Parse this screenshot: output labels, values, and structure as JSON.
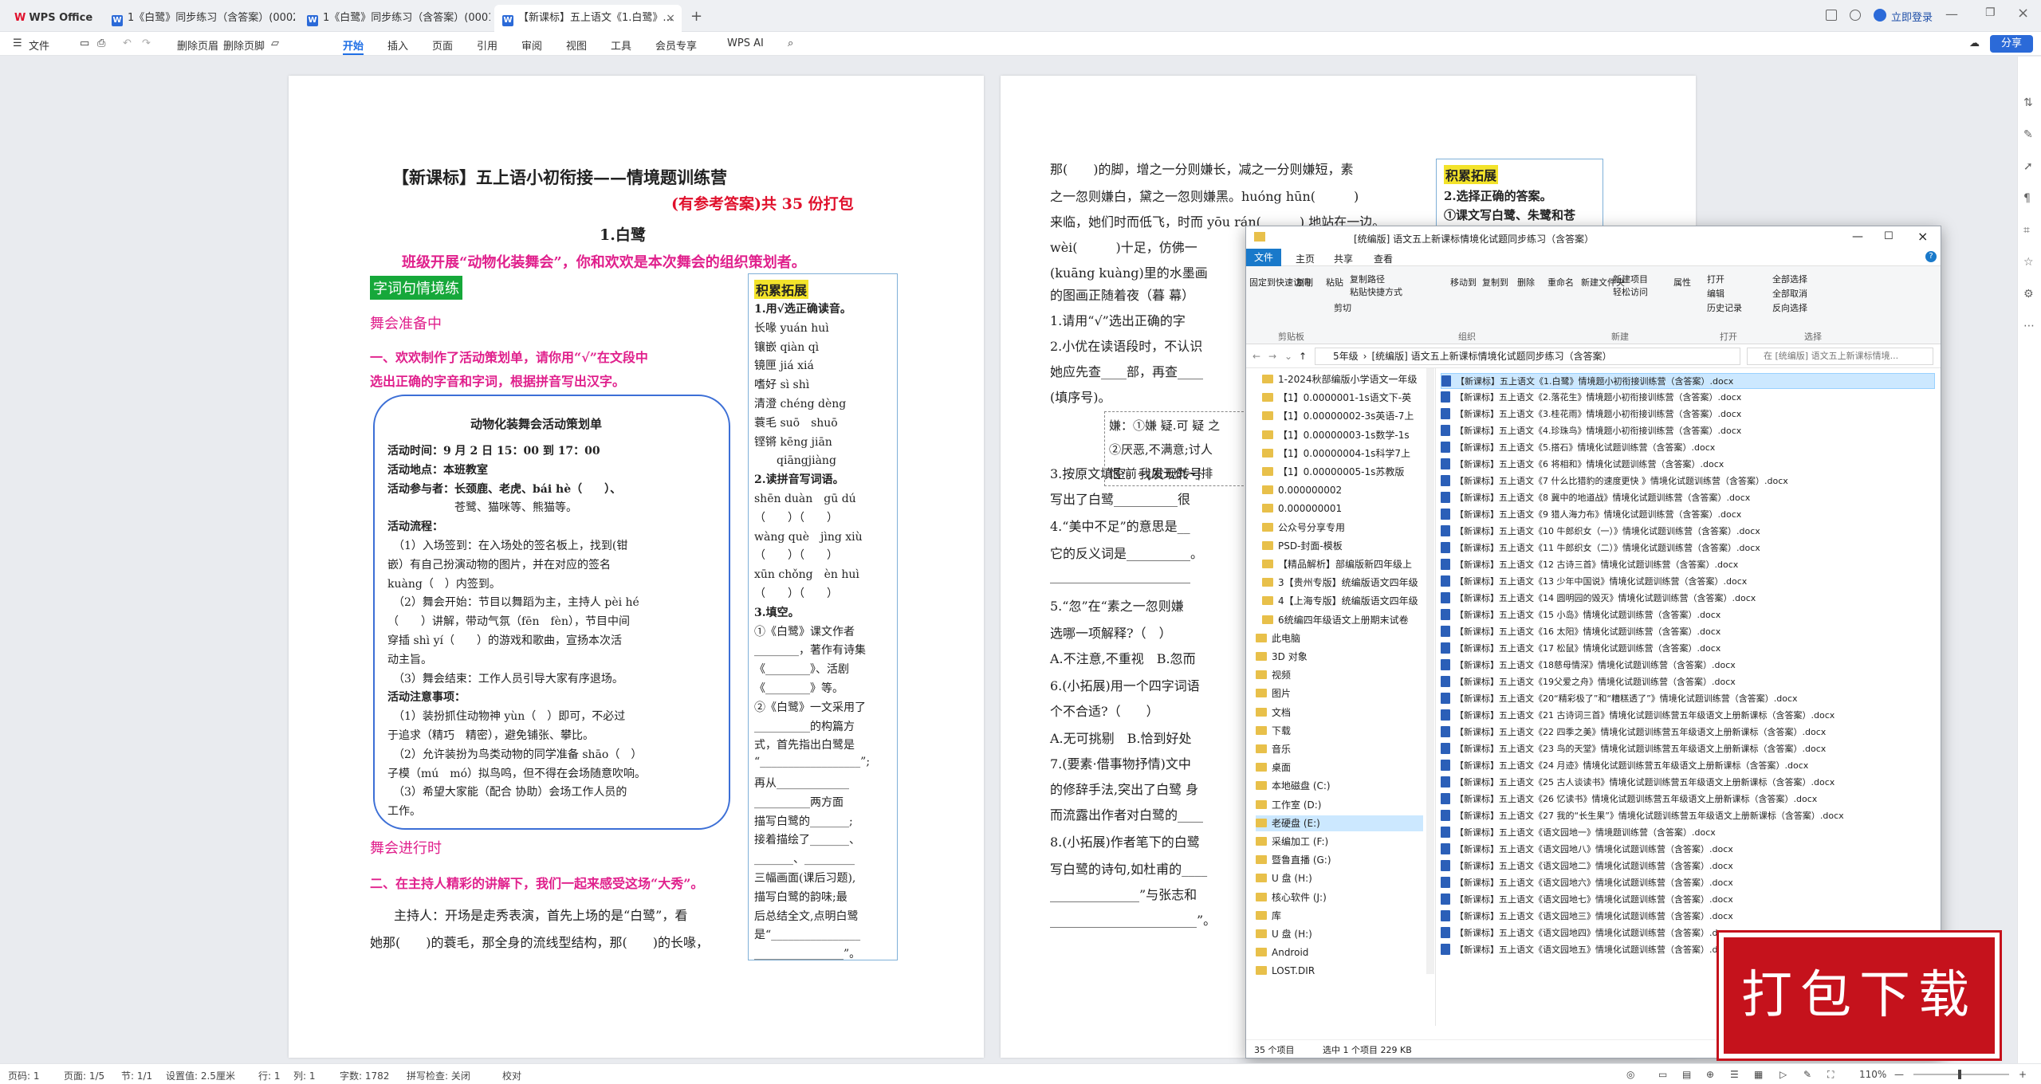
{
  "tabs": [
    {
      "label": "WPS Office"
    },
    {
      "label": "1《白鹭》同步练习（含答案）(0002..."
    },
    {
      "label": "1《白鹭》同步练习（含答案）(0001..."
    },
    {
      "label": "【新课标】五上语文《1.白鹭》..."
    }
  ],
  "titlebar": {
    "login": "立即登录",
    "add_tab": "+"
  },
  "menu": {
    "file": "文件",
    "delete_page": "删除页眉",
    "delete_footer": "删除页脚",
    "items": [
      "开始",
      "插入",
      "页面",
      "引用",
      "审阅",
      "视图",
      "工具",
      "会员专享"
    ],
    "ai": "WPS AI",
    "share": "分享"
  },
  "page1": {
    "title": "【新课标】五上语小初衔接——情境题训练营",
    "subtitle": "(有参考答案)共 35 份打包",
    "lesson": "1.白鹭",
    "intro": "班级开展“动物化装舞会”，你和欢欢是本次舞会的组织策划者。",
    "section1": "字词句情境练",
    "h_prep": "舞会准备中",
    "q1": "一、欢欢制作了活动策划单，请你用“√”在文段中",
    "q1b": "选出正确的字音和字词，根据拼音写出汉字。",
    "plan_title": "动物化装舞会活动策划单",
    "plan_lines": [
      "活动时间：9 月 2 日 15：00 到 17：00",
      "活动地点：本班教室",
      "活动参与者：长颈鹿、老虎、bái hè（　　）、",
      "　　　　　　苍鹭、猫咪等、熊猫等。",
      "活动流程：",
      "　（1）入场签到：在入场处的签名板上，找到(钳",
      "嵌）有自己扮演动物的图片，并在对应的签名",
      "kuàng（　）内签到。",
      "　（2）舞会开始：节目以舞蹈为主，主持人 pèi hé",
      "（　　）讲解，带动气氛（fēn　fèn），节目中间",
      "穿插 shì yí（　　）的游戏和歌曲，宣扬本次活",
      "动主旨。",
      "　（3）舞会结束：工作人员引导大家有序退场。",
      "活动注意事项：",
      "　（1）装扮抓住动物神 yùn（　）即可，不必过",
      "于追求（精巧　精密），避免铺张、攀比。",
      "　（2）允许装扮为鸟类动物的同学准备 shāo（　）",
      "子模（mú　mó）拟鸟鸣，但不得在会场随意吹响。",
      "　（3）希望大家能（配合 协助）会场工作人员的",
      "工作。"
    ],
    "h_progress": "舞会进行时",
    "q2": "二、在主持人精彩的讲解下，我们一起来感受这场“大秀”。",
    "host_line": "主持人：开场是走秀表演，首先上场的是“白鹭”，看",
    "host_line2": "她那(　　)的蓑毛，那全身的流线型结构，那(　　)的长喙，",
    "side_title": "积累拓展",
    "side_lines": [
      "1.用√选正确读音。",
      "长喙 yuán huì",
      "镶嵌 qiàn qì",
      "镜匣 jiá xiá",
      "嗜好 sì shì",
      "清澄 chéng dèng",
      "蓑毛 suō　shuō",
      "铿锵 kēng jiān",
      "　　qiāngjiàng",
      "2.读拼音写词语。",
      "shēn duàn　gū dú",
      "（　　）（　　）",
      "wàng què　jìng xiù",
      "（　　）（　　）",
      "xūn chǒng　èn huì",
      "（　　）（　　）",
      "3.填空。",
      "①《白鹭》课文作者",
      "________，著作有诗集",
      "《________》、活剧",
      "《________》等。",
      "②《白鹭》一文采用了",
      "__________的构篇方",
      "式，首先指出白鹭是",
      "“__________________”;",
      "再从_____________",
      "__________两方面",
      "描写白鹭的_______;",
      "接着描绘了_______、",
      "_______、_________",
      "三幅画面(课后习题),",
      "描写白鹭的韵味;最",
      "后总结全文,点明白鹭",
      "是“________________",
      "________________”。"
    ]
  },
  "page2": {
    "lines": [
      "那(　　)的脚，增之一分则嫌长，减之一分则嫌短，素",
      "之一忽则嫌白，黛之一忽则嫌黑。huóng hūn(　　　)",
      "来临，她们时而低飞，时而 yōu rán(　　　) 地站在一边。",
      "wèi(　　　)十足，仿佛一",
      "(kuāng kuàng)里的水墨画",
      "的图画正随着夜（暮 幕）",
      "1.请用“√”选出正确的字",
      "2.小优在读语段时，不认识",
      "她应先查____部，再查____",
      "(填序号)。",
      "3.按原文填空。我发现转号",
      "写出了白鹭__________很",
      "4.“美中不足”的意思是__",
      "它的反义词是__________。",
      "______________________",
      "5.“忽”在“素之一忽则嫌",
      "选哪一项解释?（　）",
      "A.不注意,不重视　B.忽而",
      "6.(小拓展)用一个四字词语",
      "个不合适?（　　）",
      "A.无可挑剔　B.恰到好处",
      "7.(要素·借事物抒情)文中",
      "的修辞手法,突出了白鹭 身",
      "而流露出作者对白鹭的____",
      "8.(小拓展)作者笔下的白鹭",
      "写白鹭的诗句,如杜甫的____",
      "______________”与张志和",
      "_______________________”。"
    ],
    "box_lines": [
      "嫌：①嫌 疑.可 疑 之",
      "②厌恶,不满意;讨人",
      "恨:前~|夙无仇~|排"
    ],
    "side_title": "积累拓展",
    "side_lines": [
      "2.选择正确的答案。",
      "①课文写白鹭、朱鹭和苍"
    ]
  },
  "explorer": {
    "title": "[统编版] 语文五上新课标情境化试题同步练习（含答案）",
    "ribbon_tabs": [
      "文件",
      "主页",
      "共享",
      "查看"
    ],
    "groups": [
      "剪贴板",
      "组织",
      "新建",
      "打开",
      "选择"
    ],
    "buttons": [
      "固定到快速访问",
      "复制",
      "粘贴",
      "复制路径",
      "粘贴快捷方式",
      "剪切",
      "移动到",
      "复制到",
      "删除",
      "重命名",
      "新建文件夹",
      "新建项目",
      "轻松访问",
      "属性",
      "打开",
      "编辑",
      "历史记录",
      "全部选择",
      "全部取消",
      "反向选择"
    ],
    "path": [
      "5年级",
      "[统编版] 语文五上新课标情境化试题同步练习（含答案）"
    ],
    "search_placeholder": "在 [统编版] 语文五上新课标情境...",
    "nav": [
      {
        "label": "1-2024秋部编版小学语文一年级"
      },
      {
        "label": "【1】0.0000001-1s语文下-英"
      },
      {
        "label": "【1】0.00000002-3s英语-7上"
      },
      {
        "label": "【1】0.00000003-1s数学-1s"
      },
      {
        "label": "【1】0.00000004-1s科学7上"
      },
      {
        "label": "【1】0.00000005-1s苏教版"
      },
      {
        "label": "0.000000002"
      },
      {
        "label": "0.000000001"
      },
      {
        "label": "公众号分享专用"
      },
      {
        "label": "PSD-封面-模板"
      },
      {
        "label": "【精品解析】部编版新四年级上"
      },
      {
        "label": "3【贵州专版】统编版语文四年级"
      },
      {
        "label": "4【上海专版】统编版语文四年级"
      },
      {
        "label": "6统编四年级语文上册期末试卷"
      },
      {
        "label": "此电脑"
      },
      {
        "label": "3D 对象"
      },
      {
        "label": "视频"
      },
      {
        "label": "图片"
      },
      {
        "label": "文档"
      },
      {
        "label": "下载"
      },
      {
        "label": "音乐"
      },
      {
        "label": "桌面"
      },
      {
        "label": "本地磁盘 (C:)"
      },
      {
        "label": "工作室 (D:)"
      },
      {
        "label": "老硬盘 (E:)"
      },
      {
        "label": "采编加工 (F:)"
      },
      {
        "label": "暨鲁直播 (G:)"
      },
      {
        "label": "U 盘 (H:)"
      },
      {
        "label": "核心软件 (J:)"
      },
      {
        "label": "库"
      },
      {
        "label": "U 盘 (H:)"
      },
      {
        "label": "Android"
      },
      {
        "label": "LOST.DIR"
      }
    ],
    "files": [
      "【新课标】五上语文《1.白鹭》情境题小初衔接训练营（含答案）.docx",
      "【新课标】五上语文《2.落花生》情境题小初衔接训练营（含答案）.docx",
      "【新课标】五上语文《3.桂花雨》情境题小初衔接训练营（含答案）.docx",
      "【新课标】五上语文《4.珍珠鸟》情境题小初衔接训练营（含答案）.docx",
      "【新课标】五上语文《5.搭石》情境化试题训练营（含答案）.docx",
      "【新课标】五上语文《6 将相和》情境化试题训练营（含答案）.docx",
      "【新课标】五上语文《7 什么比猎豹的速度更快 》情境化试题训练营（含答案）.docx",
      "【新课标】五上语文《8 冀中的地道战》情境化试题训练营（含答案）.docx",
      "【新课标】五上语文《9 猎人海力布》情境化试题训练营（含答案）.docx",
      "【新课标】五上语文《10 牛郎织女（一）》情境化试题训练营（含答案）.docx",
      "【新课标】五上语文《11 牛郎织女（二）》情境化试题训练营（含答案）.docx",
      "【新课标】五上语文《12 古诗三首》情境化试题训练营（含答案）.docx",
      "【新课标】五上语文《13 少年中国说》情境化试题训练营（含答案）.docx",
      "【新课标】五上语文《14 圆明园的毁灭》情境化试题训练营（含答案）.docx",
      "【新课标】五上语文《15 小岛》情境化试题训练营（含答案）.docx",
      "【新课标】五上语文《16 太阳》情境化试题训练营（含答案）.docx",
      "【新课标】五上语文《17 松鼠》情境化试题训练营（含答案）.docx",
      "【新课标】五上语文《18慈母情深》情境化试题训练营（含答案）.docx",
      "【新课标】五上语文《19父爱之舟》情境化试题训练营（含答案）.docx",
      "【新课标】五上语文《20“精彩极了”和“糟糕透了”》情境化试题训练营（含答案）.docx",
      "【新课标】五上语文《21 古诗词三首》情境化试题训练营五年级语文上册新课标（含答案）.docx",
      "【新课标】五上语文《22 四季之美》情境化试题训练营五年级语文上册新课标（含答案）.docx",
      "【新课标】五上语文《23 鸟的天堂》情境化试题训练营五年级语文上册新课标（含答案）.docx",
      "【新课标】五上语文《24 月迹》情境化试题训练营五年级语文上册新课标（含答案）.docx",
      "【新课标】五上语文《25 古人谈读书》情境化试题训练营五年级语文上册新课标（含答案）.docx",
      "【新课标】五上语文《26 忆读书》情境化试题训练营五年级语文上册新课标（含答案）.docx",
      "【新课标】五上语文《27 我的“长生果”》情境化试题训练营五年级语文上册新课标（含答案）.docx",
      "【新课标】五上语文《语文园地一》情境题训练营（含答案）.docx",
      "【新课标】五上语文《语文园地八》情境化试题训练营（含答案）.docx",
      "【新课标】五上语文《语文园地二》情境化试题训练营（含答案）.docx",
      "【新课标】五上语文《语文园地六》情境化试题训练营（含答案）.docx",
      "【新课标】五上语文《语文园地七》情境化试题训练营（含答案）.docx",
      "【新课标】五上语文《语文园地三》情境化试题训练营（含答案）.docx",
      "【新课标】五上语文《语文园地四》情境化试题训练营（含答案）.docx",
      "【新课标】五上语文《语文园地五》情境化试题训练营（含答案）.docx"
    ],
    "status_count": "35 个项目",
    "status_selected": "选中 1 个项目  229 KB"
  },
  "stamp": "打包下载",
  "status": {
    "page_num": "页码: 1",
    "pages": "页面: 1/5",
    "section": "节: 1/1",
    "setting": "设置值: 2.5厘米",
    "row": "行: 1",
    "col": "列: 1",
    "words": "字数: 1782",
    "spell": "拼写检查: 关闭",
    "proof": "校对",
    "zoom": "110%"
  }
}
